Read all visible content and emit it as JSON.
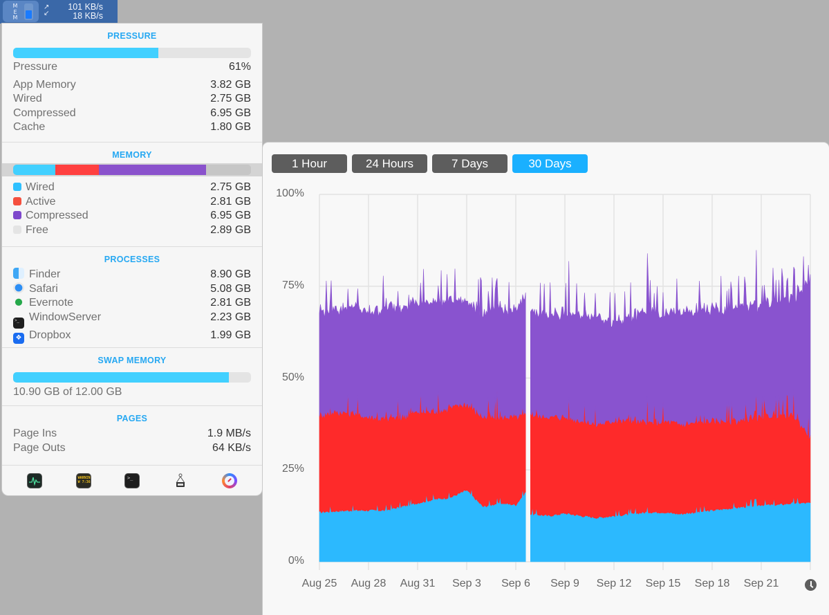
{
  "menubar": {
    "mem_label": "MEM",
    "mem_gauge_percent": 61,
    "net_arrows": "↗↙",
    "upload_rate": "101 KB/s",
    "download_rate": "18 KB/s"
  },
  "pressure": {
    "title": "PRESSURE",
    "percent": 61,
    "label": "Pressure",
    "value": "61%",
    "rows": [
      {
        "label": "App Memory",
        "value": "3.82 GB"
      },
      {
        "label": "Wired",
        "value": "2.75 GB"
      },
      {
        "label": "Compressed",
        "value": "6.95 GB"
      },
      {
        "label": "Cache",
        "value": "1.80 GB"
      }
    ]
  },
  "memory": {
    "title": "MEMORY",
    "bar_segments": [
      {
        "name": "Wired",
        "gb": 2.75,
        "color": "#42d0ff"
      },
      {
        "name": "Active",
        "gb": 2.81,
        "color": "#ff4040"
      },
      {
        "name": "Compressed",
        "gb": 6.95,
        "color": "#8a52cc"
      },
      {
        "name": "Free",
        "gb": 2.89,
        "color": "#c6c6c6"
      }
    ],
    "rows": [
      {
        "label": "Wired",
        "value": "2.75 GB",
        "color": "#2ec0ff"
      },
      {
        "label": "Active",
        "value": "2.81 GB",
        "color": "#f5503e"
      },
      {
        "label": "Compressed",
        "value": "6.95 GB",
        "color": "#7e48cc"
      },
      {
        "label": "Free",
        "value": "2.89 GB",
        "color": "#e4e4e4"
      }
    ]
  },
  "processes": {
    "title": "PROCESSES",
    "rows": [
      {
        "label": "Finder",
        "value": "8.90 GB",
        "icon": "finder-icon"
      },
      {
        "label": "Safari",
        "value": "5.08 GB",
        "icon": "safari-icon"
      },
      {
        "label": "Evernote",
        "value": "2.81 GB",
        "icon": "evernote-icon"
      },
      {
        "label": "WindowServer",
        "value": "2.23 GB",
        "icon": "terminal-icon"
      },
      {
        "label": "Dropbox",
        "value": "1.99 GB",
        "icon": "dropbox-icon"
      }
    ]
  },
  "swap": {
    "title": "SWAP MEMORY",
    "used_gb": 10.9,
    "total_gb": 12.0,
    "text": "10.90 GB of 12.00 GB"
  },
  "pages": {
    "title": "PAGES",
    "rows": [
      {
        "label": "Page Ins",
        "value": "1.9 MB/s"
      },
      {
        "label": "Page Outs",
        "value": "64 KB/s"
      }
    ]
  },
  "footer": {
    "icons": [
      "activity-monitor-icon",
      "console-icon",
      "terminal-icon",
      "system-information-icon",
      "istat-menus-icon"
    ],
    "console_text": "WARNIN\nW 7:36"
  },
  "history": {
    "ranges": [
      {
        "label": "1 Hour",
        "active": false
      },
      {
        "label": "24 Hours",
        "active": false
      },
      {
        "label": "7 Days",
        "active": false
      },
      {
        "label": "30 Days",
        "active": true
      }
    ]
  },
  "chart_data": {
    "type": "area",
    "stacked": true,
    "title": "",
    "xlabel": "",
    "ylabel": "",
    "ylim": [
      0,
      100
    ],
    "yticks": [
      "0%",
      "25%",
      "50%",
      "75%",
      "100%"
    ],
    "xticks": [
      "Aug 25",
      "Aug 28",
      "Aug 31",
      "Sep 3",
      "Sep 6",
      "Sep 9",
      "Sep 12",
      "Sep 15",
      "Sep 18",
      "Sep 21"
    ],
    "xrange_days": [
      0,
      30
    ],
    "gap_days": [
      12.6,
      12.85
    ],
    "grid": true,
    "x_days": [
      0,
      1,
      2,
      3,
      4,
      5,
      6,
      7,
      8,
      9,
      10,
      11,
      12,
      12.6,
      12.85,
      13,
      14,
      15,
      16,
      17,
      18,
      19,
      20,
      21,
      22,
      23,
      24,
      25,
      26,
      27,
      28,
      29,
      30
    ],
    "series": [
      {
        "name": "Wired",
        "color": "#2cb9fe",
        "values": [
          13.5,
          13.8,
          14,
          14,
          14,
          15,
          16,
          17,
          17.5,
          19.5,
          15,
          16,
          15.5,
          19,
          13,
          13,
          12.5,
          13.2,
          12.5,
          12,
          12.5,
          13,
          13.5,
          13.5,
          13,
          13.5,
          14,
          14.5,
          15,
          15.5,
          15.5,
          16,
          16
        ]
      },
      {
        "name": "Active",
        "color": "#fe2a2a",
        "values": [
          26.5,
          27.2,
          26.5,
          25.5,
          25,
          24.5,
          25,
          24,
          24.5,
          23.5,
          24.5,
          23.5,
          24,
          21,
          27,
          27,
          27,
          26.3,
          26,
          25.5,
          26,
          25.5,
          24.5,
          25,
          24.5,
          24.5,
          24.5,
          24,
          23.5,
          24,
          24.5,
          24,
          18
        ]
      },
      {
        "name": "Compressed",
        "color": "#8953cf",
        "values": [
          28.5,
          28,
          29,
          28.5,
          30,
          30,
          29.5,
          30,
          29,
          28,
          28.5,
          29.5,
          28.5,
          32,
          28,
          28,
          28,
          28.5,
          29,
          30,
          26.5,
          27.5,
          30.5,
          29,
          30.5,
          30,
          30,
          30.5,
          31,
          30,
          31.5,
          32,
          43
        ]
      }
    ]
  }
}
